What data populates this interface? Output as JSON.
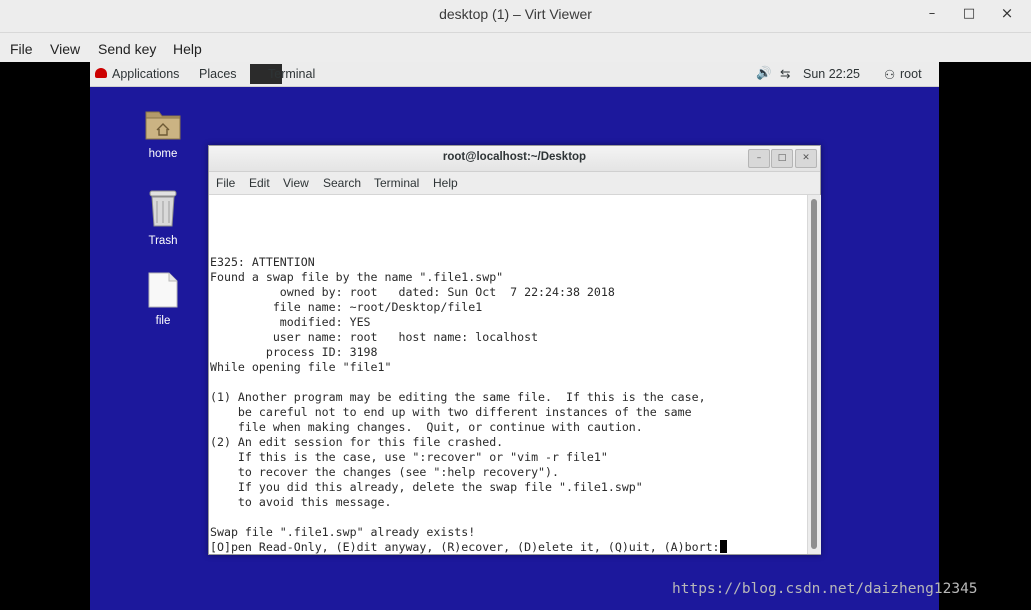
{
  "window": {
    "title": "desktop (1) – Virt Viewer",
    "minimize": "–",
    "maximize": "□",
    "close": "×"
  },
  "outer_menu": [
    "File",
    "View",
    "Send key",
    "Help"
  ],
  "panel": {
    "applications": "Applications",
    "places": "Places",
    "task": "Terminal",
    "volume_icon": "🔊",
    "network_icon": "⇆",
    "clock": "Sun 22:25",
    "user_icon": "⚇",
    "user": "root"
  },
  "desktop_icons": [
    {
      "label": "home"
    },
    {
      "label": "Trash"
    },
    {
      "label": "file"
    }
  ],
  "terminal": {
    "title": "root@localhost:~/Desktop",
    "menu": [
      "File",
      "Edit",
      "View",
      "Search",
      "Terminal",
      "Help"
    ],
    "lines": [
      "E325: ATTENTION",
      "Found a swap file by the name \".file1.swp\"",
      "          owned by: root   dated: Sun Oct  7 22:24:38 2018",
      "         file name: ~root/Desktop/file1",
      "          modified: YES",
      "         user name: root   host name: localhost",
      "        process ID: 3198",
      "While opening file \"file1\"",
      "",
      "(1) Another program may be editing the same file.  If this is the case,",
      "    be careful not to end up with two different instances of the same",
      "    file when making changes.  Quit, or continue with caution.",
      "(2) An edit session for this file crashed.",
      "    If this is the case, use \":recover\" or \"vim -r file1\"",
      "    to recover the changes (see \":help recovery\").",
      "    If you did this already, delete the swap file \".file1.swp\"",
      "    to avoid this message.",
      "",
      "Swap file \".file1.swp\" already exists!"
    ],
    "prompt": "[O]pen Read-Only, (E)dit anyway, (R)ecover, (D)elete it, (Q)uit, (A)bort:"
  },
  "watermark": "https://blog.csdn.net/daizheng12345"
}
